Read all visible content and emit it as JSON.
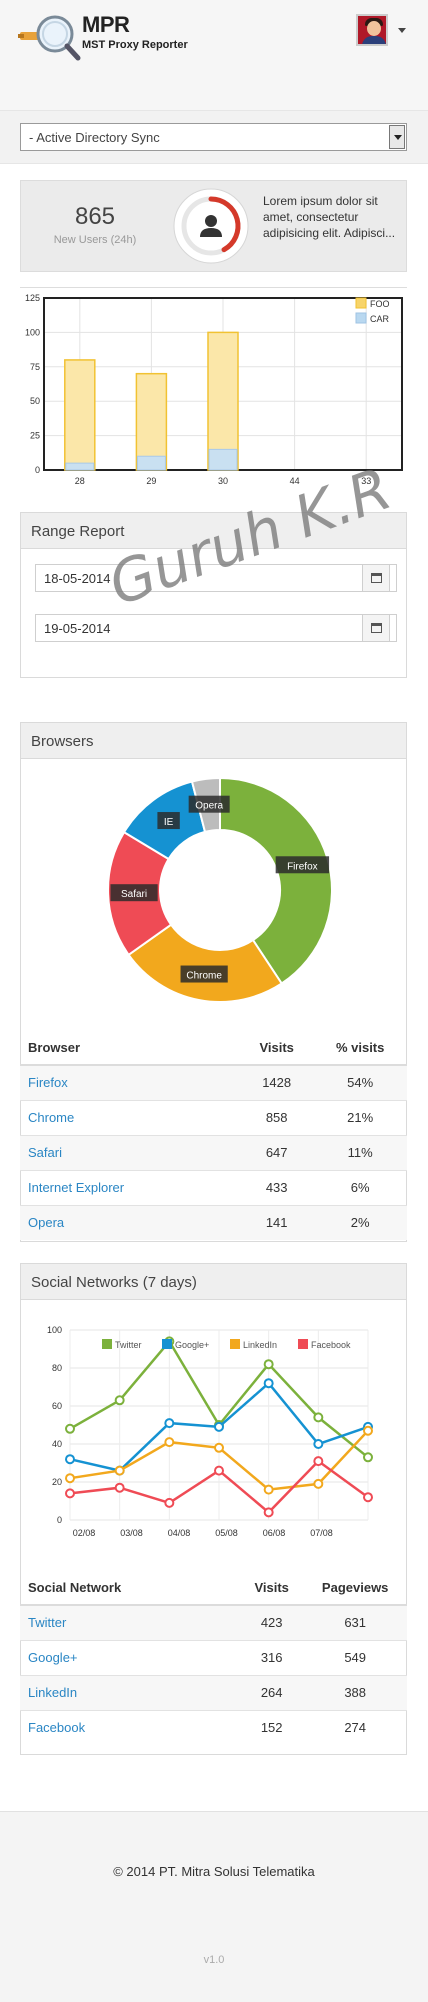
{
  "header": {
    "app_name": "MPR",
    "app_subtitle": "MST Proxy Reporter"
  },
  "sync_select": {
    "value": "- Active Directory Sync"
  },
  "stats": {
    "new_users_value": "865",
    "new_users_label": "New Users (24h)",
    "new_users_ring_fraction": 0.42,
    "description": "Lorem ipsum dolor sit amet, consectetur adipisicing elit. Adipisci..."
  },
  "overlay_text": "Guruh K.R",
  "bar_chart": {
    "chart_data": {
      "type": "bar",
      "categories": [
        "28",
        "29",
        "30",
        "44",
        "33"
      ],
      "x_tick_labels": [
        "28",
        "29",
        "30",
        "44",
        "33"
      ],
      "series": [
        {
          "name": "FOO",
          "values": [
            80,
            70,
            100
          ],
          "color": "#f1c232"
        },
        {
          "name": "CAR",
          "values": [
            5,
            10,
            15
          ],
          "color": "#b9d8f0"
        }
      ],
      "ylim": [
        0,
        125
      ],
      "y_ticks": [
        "0",
        "25",
        "50",
        "75",
        "100",
        "125"
      ],
      "legend_position": "top-right",
      "grid": true
    }
  },
  "range_report": {
    "title": "Range Report",
    "start_date": "18-05-2014",
    "end_date": "19-05-2014"
  },
  "browsers": {
    "title": "Browsers",
    "chart_data": {
      "type": "pie",
      "labels": [
        "Firefox",
        "Chrome",
        "Safari",
        "IE",
        "Opera"
      ],
      "values": [
        1428,
        858,
        647,
        433,
        141
      ],
      "colors": [
        "#7cb13c",
        "#f2a81d",
        "#ef4b55",
        "#1592d2",
        "#bcbcbc"
      ]
    },
    "table": {
      "headers": [
        "Browser",
        "Visits",
        "% visits"
      ],
      "rows": [
        [
          "Firefox",
          "1428",
          "54%"
        ],
        [
          "Chrome",
          "858",
          "21%"
        ],
        [
          "Safari",
          "647",
          "11%"
        ],
        [
          "Internet Explorer",
          "433",
          "6%"
        ],
        [
          "Opera",
          "141",
          "2%"
        ]
      ]
    }
  },
  "social": {
    "title": "Social Networks (7 days)",
    "chart_data": {
      "type": "line",
      "x": [
        "02/08",
        "03/08",
        "04/08",
        "05/08",
        "06/08",
        "07/08"
      ],
      "ylim": [
        0,
        100
      ],
      "y_ticks": [
        "0",
        "20",
        "40",
        "60",
        "80",
        "100"
      ],
      "grid": true,
      "legend_position": "top",
      "series": [
        {
          "name": "Twitter",
          "color": "#7cb13c",
          "values": [
            48,
            63,
            94,
            50,
            82,
            54,
            33
          ]
        },
        {
          "name": "Google+",
          "color": "#1592d2",
          "values": [
            32,
            26,
            51,
            49,
            72,
            40,
            49
          ]
        },
        {
          "name": "LinkedIn",
          "color": "#f2a81d",
          "values": [
            22,
            26,
            41,
            38,
            16,
            19,
            47
          ]
        },
        {
          "name": "Facebook",
          "color": "#ef4b55",
          "values": [
            14,
            17,
            9,
            26,
            4,
            31,
            12
          ]
        }
      ]
    },
    "table": {
      "headers": [
        "Social Network",
        "Visits",
        "Pageviews"
      ],
      "rows": [
        [
          "Twitter",
          "423",
          "631"
        ],
        [
          "Google+",
          "316",
          "549"
        ],
        [
          "LinkedIn",
          "264",
          "388"
        ],
        [
          "Facebook",
          "152",
          "274"
        ]
      ]
    }
  },
  "footer": {
    "copyright": "© 2014 PT. Mitra Solusi Telematika",
    "version": "v1.0"
  }
}
